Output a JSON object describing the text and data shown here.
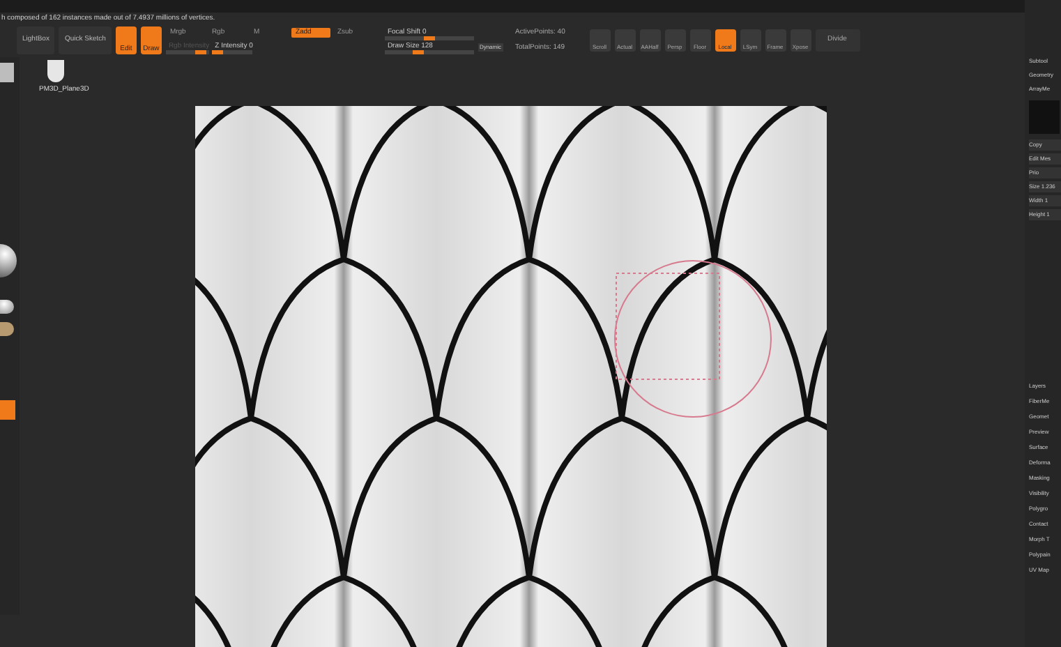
{
  "status_message": "h composed of 162 instances made out of 7.4937 millions of vertices.",
  "toolbar_left": [
    {
      "label": "LightBox"
    },
    {
      "label": "Quick Sketch"
    }
  ],
  "mode_buttons": [
    {
      "label": "Edit",
      "selected": true
    },
    {
      "label": "Draw",
      "selected": true
    }
  ],
  "channel_toggles": [
    {
      "label": "Mrgb",
      "selected": false
    },
    {
      "label": "Rgb",
      "selected": false
    },
    {
      "label": "M",
      "selected": false
    },
    {
      "label": "Zadd",
      "selected": true
    },
    {
      "label": "Zsub",
      "selected": false
    }
  ],
  "sliders": [
    {
      "label": "Rgb Intensity",
      "level": 0.95,
      "disabled": true
    },
    {
      "label": "Z Intensity 0",
      "level": 0.0,
      "disabled": false
    },
    {
      "label": "Focal Shift 0",
      "level": 0.5,
      "disabled": false
    },
    {
      "label": "Draw Size 128",
      "level": 0.35,
      "disabled": false
    }
  ],
  "dynamic_button": "Dynamic",
  "points": [
    "ActivePoints: 40",
    "TotalPoints: 149"
  ],
  "view_buttons": [
    {
      "label": "Scroll",
      "selected": false
    },
    {
      "label": "Actual",
      "selected": false
    },
    {
      "label": "AAHalf",
      "selected": false
    },
    {
      "label": "Persp",
      "selected": false
    },
    {
      "label": "Floor",
      "selected": false
    },
    {
      "label": "Local",
      "selected": true
    },
    {
      "label": "LSym",
      "selected": false
    },
    {
      "label": "Frame",
      "selected": false
    },
    {
      "label": "Xpose",
      "selected": false
    }
  ],
  "divide_button": "Divide",
  "tool_thumbnail": "PM3D_Plane3D",
  "right_panel": {
    "top_items": [
      "Subtool",
      "Geometry",
      "ArrayMe"
    ],
    "sub_items": [
      "Copy",
      "Edit Mes",
      "Prio",
      "Size 1.236",
      "Width 1",
      "Height 1"
    ],
    "bottom_items": [
      "Layers",
      "FiberMe",
      "Geomet",
      "Preview",
      "Surface",
      "Deforma",
      "Masking",
      "Visibility",
      "Polygro",
      "Contact",
      "Morph T",
      "Polypain",
      "UV Map"
    ]
  }
}
